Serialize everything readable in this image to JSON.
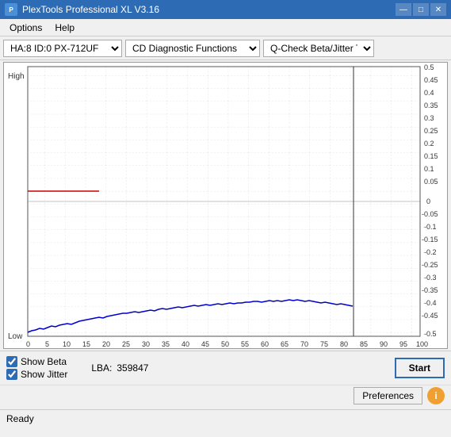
{
  "titlebar": {
    "title": "PlexTools Professional XL V3.16",
    "minimize": "—",
    "maximize": "□",
    "close": "✕"
  },
  "menubar": {
    "items": [
      "Options",
      "Help"
    ]
  },
  "toolbar": {
    "drive_select": {
      "value": "HA:8 ID:0  PX-712UF",
      "options": [
        "HA:8 ID:0  PX-712UF"
      ]
    },
    "function_select": {
      "value": "CD Diagnostic Functions",
      "options": [
        "CD Diagnostic Functions"
      ]
    },
    "test_select": {
      "value": "Q-Check Beta/Jitter Test",
      "options": [
        "Q-Check Beta/Jitter Test"
      ]
    }
  },
  "chart": {
    "y_label_high": "High",
    "y_label_low": "Low",
    "y_axis_right": [
      0.5,
      0.45,
      0.4,
      0.35,
      0.3,
      0.25,
      0.2,
      0.15,
      0.1,
      0.05,
      0,
      -0.05,
      -0.1,
      -0.15,
      -0.2,
      -0.25,
      -0.3,
      -0.35,
      -0.4,
      -0.45,
      -0.5
    ],
    "x_axis": [
      0,
      5,
      10,
      15,
      20,
      25,
      30,
      35,
      40,
      45,
      50,
      55,
      60,
      65,
      70,
      75,
      80,
      85,
      90,
      95,
      100
    ]
  },
  "bottom": {
    "show_beta_label": "Show Beta",
    "show_jitter_label": "Show Jitter",
    "show_beta_checked": true,
    "show_jitter_checked": true,
    "lba_label": "LBA:",
    "lba_value": "359847",
    "start_label": "Start",
    "preferences_label": "Preferences",
    "info_label": "i"
  },
  "statusbar": {
    "status": "Ready"
  }
}
